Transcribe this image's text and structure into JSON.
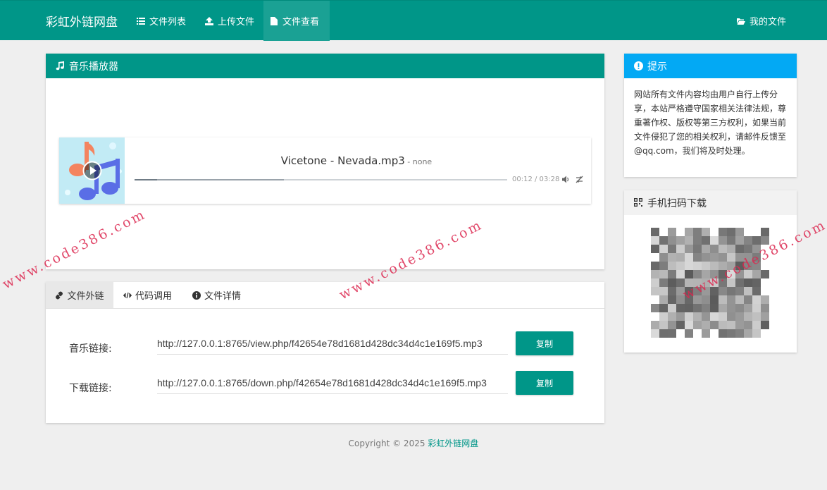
{
  "navbar": {
    "brand": "彩虹外链网盘",
    "items": [
      {
        "label": "文件列表",
        "icon": "list-icon"
      },
      {
        "label": "上传文件",
        "icon": "upload-icon"
      },
      {
        "label": "文件查看",
        "icon": "file-icon",
        "active": true
      }
    ],
    "my_files": {
      "label": "我的文件",
      "icon": "folder-open-icon"
    }
  },
  "player_panel": {
    "title": "音乐播放器",
    "icon": "music-note-icon",
    "player": {
      "song_title": "Vicetone - Nevada.mp3",
      "artist": " - none",
      "time": "00:12 / 03:28",
      "progress": 0.06,
      "buffered": 0.4
    }
  },
  "tabs": [
    {
      "label": "文件外链",
      "icon": "link-icon",
      "active": true
    },
    {
      "label": "代码调用",
      "icon": "code-icon"
    },
    {
      "label": "文件详情",
      "icon": "info-circle-icon"
    }
  ],
  "links": [
    {
      "label": "音乐链接:",
      "value": "http://127.0.0.1:8765/view.php/f42654e78d1681d428dc34d4c1e169f5.mp3",
      "button": "复制"
    },
    {
      "label": "下载链接:",
      "value": "http://127.0.0.1:8765/down.php/f42654e78d1681d428dc34d4c1e169f5.mp3",
      "button": "复制"
    }
  ],
  "tip_panel": {
    "title": "提示",
    "icon": "exclamation-circle-icon",
    "text": "网站所有文件内容均由用户自行上传分享，本站严格遵守国家相关法律法规，尊重著作权、版权等第三方权利，如果当前文件侵犯了您的相关权利，请邮件反馈至@qq.com，我们将及时处理。"
  },
  "qr_panel": {
    "title": "手机扫码下载",
    "icon": "qrcode-icon"
  },
  "footer": {
    "copyright": "Copyright © 2025 ",
    "site": "彩虹外链网盘"
  },
  "watermark": "www.code386.com",
  "colors": {
    "primary": "#009688",
    "info": "#03a9f4",
    "background": "#efefef"
  }
}
